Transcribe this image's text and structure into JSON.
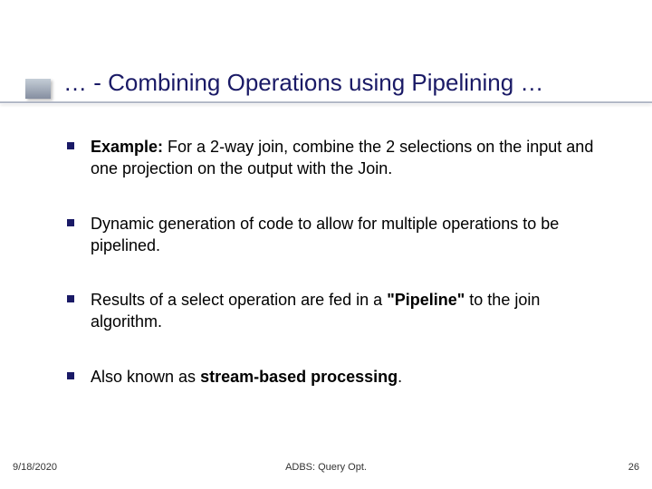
{
  "title": "… - Combining Operations using Pipelining …",
  "bullets": [
    {
      "prefix_bold": "Example:",
      "rest": "  For a 2-way join, combine the 2 selections on the input and one projection on the output with the Join."
    },
    {
      "plain": "Dynamic generation of code to allow for multiple operations to be pipelined."
    },
    {
      "pre": "Results of a select operation are fed in a ",
      "mid_bold": "\"Pipeline\"",
      "post": " to the join algorithm."
    },
    {
      "pre": "Also known as ",
      "mid_bold": "stream-based processing",
      "post": "."
    }
  ],
  "footer": {
    "date": "9/18/2020",
    "center": "ADBS: Query Opt.",
    "page": "26"
  }
}
